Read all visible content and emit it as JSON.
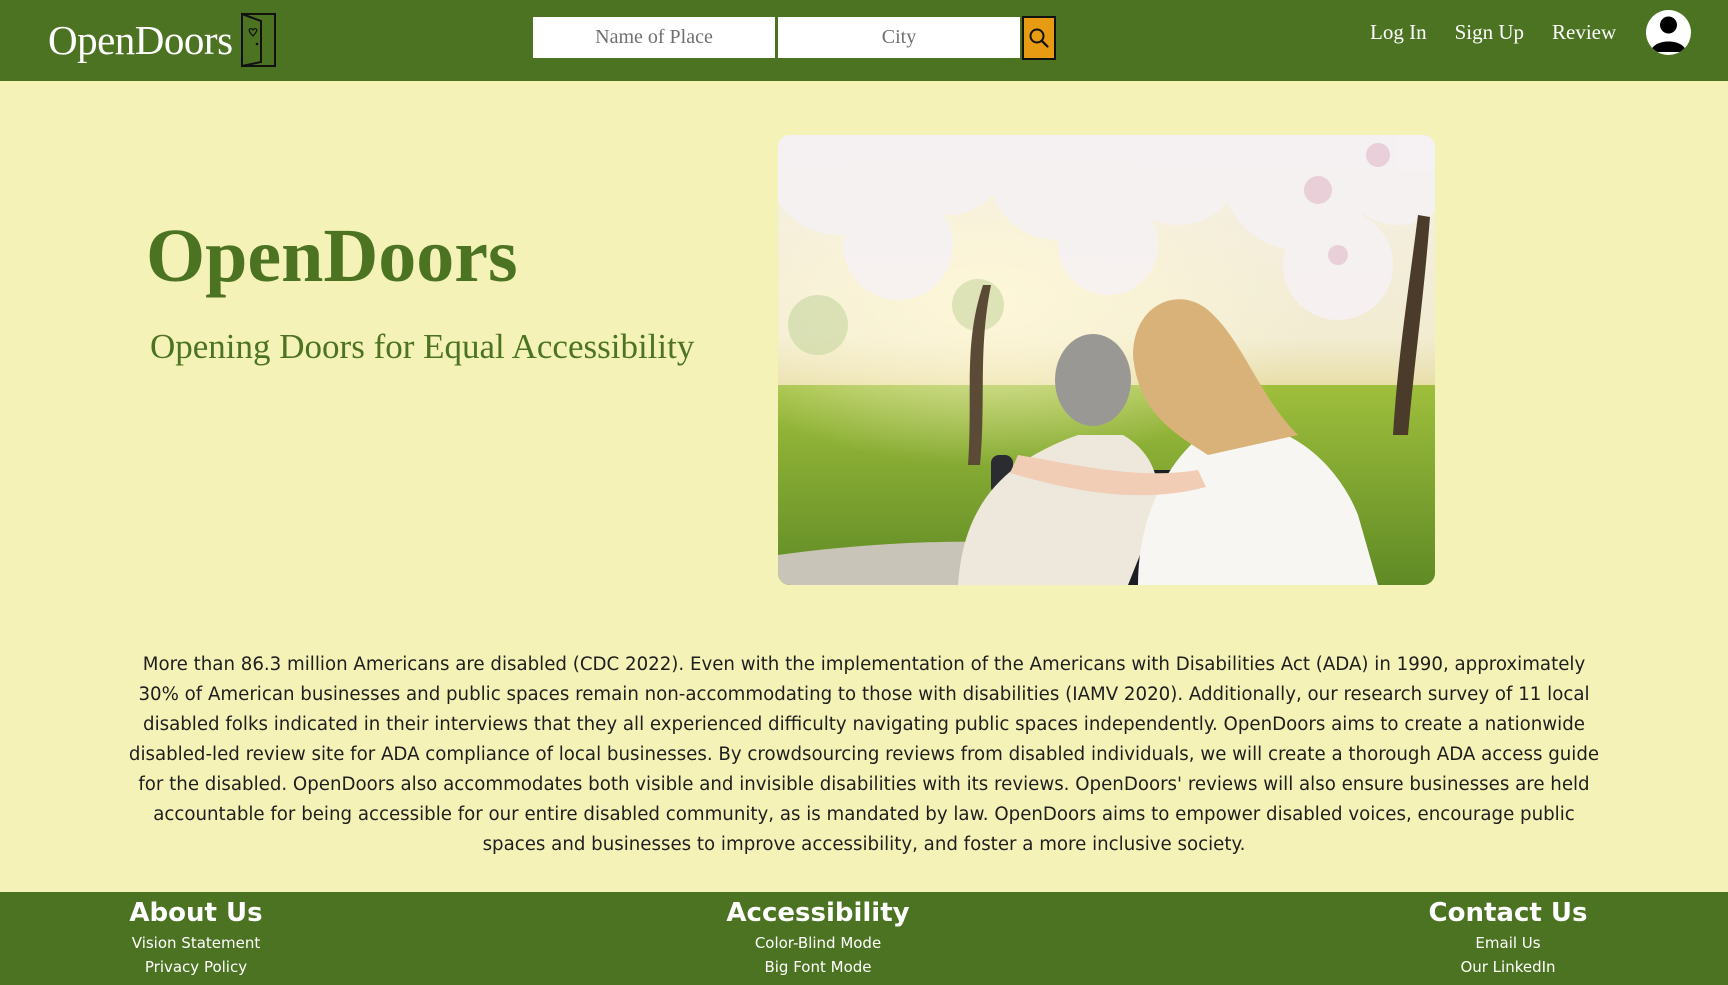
{
  "header": {
    "logo_text": "OpenDoors",
    "search": {
      "place_placeholder": "Name of Place",
      "city_placeholder": "City"
    },
    "nav": [
      "Log In",
      "Sign Up",
      "Review"
    ]
  },
  "hero": {
    "title": "OpenDoors",
    "subtitle": "Opening Doors for Equal Accessibility"
  },
  "mission": "More than 86.3 million Americans are disabled (CDC 2022). Even with the implementation of the Americans with Disabilities Act (ADA) in 1990, approximately 30% of American businesses and public spaces remain non-accommodating to those with disabilities (IAMV 2020). Additionally, our research survey of 11 local disabled folks indicated in their interviews that they all experienced difficulty navigating public spaces independently. OpenDoors aims to create a nationwide disabled-led review site for ADA compliance of local businesses. By crowdsourcing reviews from disabled individuals, we will create a thorough ADA access guide for the disabled. OpenDoors also accommodates both visible and invisible disabilities with its reviews. OpenDoors' reviews will also ensure businesses are held accountable for being accessible for our entire disabled community, as is mandated by law. OpenDoors aims to empower disabled voices, encourage public spaces and businesses to improve accessibility, and foster a more inclusive society.",
  "footer": {
    "about": {
      "title": "About Us",
      "links": [
        "Vision Statement",
        "Privacy Policy"
      ]
    },
    "accessibility": {
      "title": "Accessibility",
      "links": [
        "Color-Blind Mode",
        "Big Font Mode"
      ]
    },
    "contact": {
      "title": "Contact Us",
      "links": [
        "Email Us",
        "Our LinkedIn"
      ]
    }
  },
  "colors": {
    "header_green": "#4c7322",
    "page_background": "#f5f2b8",
    "search_button": "#e69b12"
  },
  "icons": {
    "logo": "open-door-icon",
    "search": "search-icon",
    "account": "user-avatar-icon"
  }
}
